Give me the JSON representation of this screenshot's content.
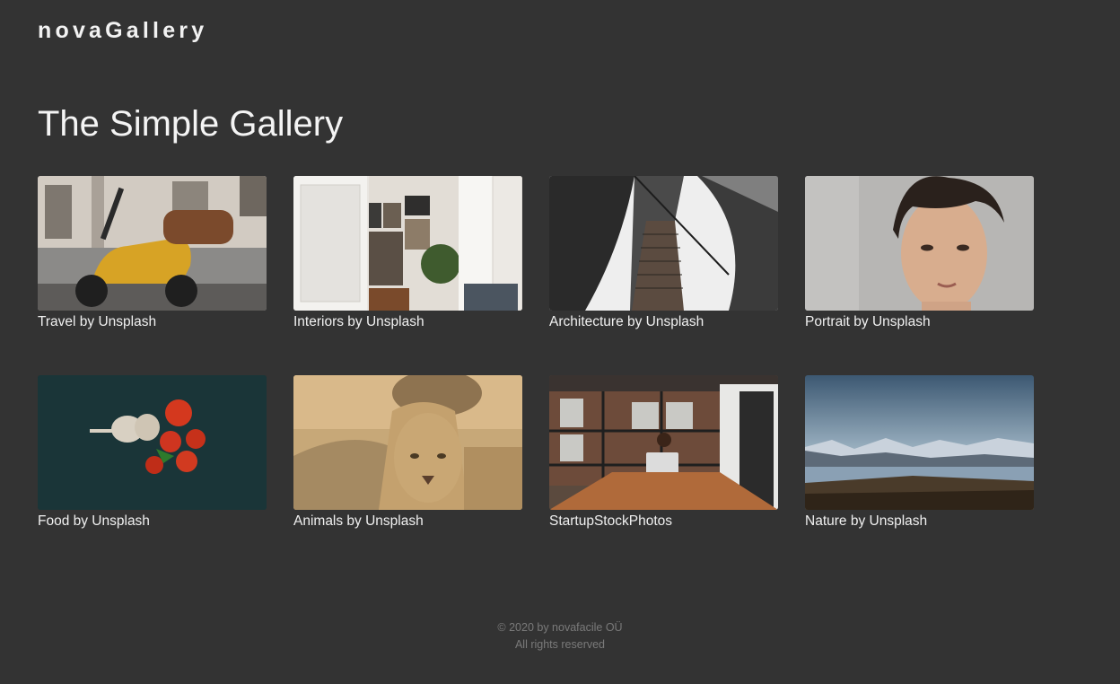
{
  "header": {
    "brand": "novaGallery"
  },
  "main": {
    "title": "The Simple Gallery"
  },
  "gallery": {
    "items": [
      {
        "caption": "Travel by Unsplash",
        "icon": "scooter-photo"
      },
      {
        "caption": "Interiors by Unsplash",
        "icon": "interior-photo"
      },
      {
        "caption": "Architecture by Unsplash",
        "icon": "skyscraper-photo"
      },
      {
        "caption": "Portrait by Unsplash",
        "icon": "portrait-photo"
      },
      {
        "caption": "Food by Unsplash",
        "icon": "tomatoes-photo"
      },
      {
        "caption": "Animals by Unsplash",
        "icon": "lion-photo"
      },
      {
        "caption": "StartupStockPhotos",
        "icon": "office-photo"
      },
      {
        "caption": "Nature by Unsplash",
        "icon": "lake-photo"
      }
    ]
  },
  "footer": {
    "copyright": "© 2020 by novafacile OÜ",
    "rights": "All rights reserved"
  }
}
